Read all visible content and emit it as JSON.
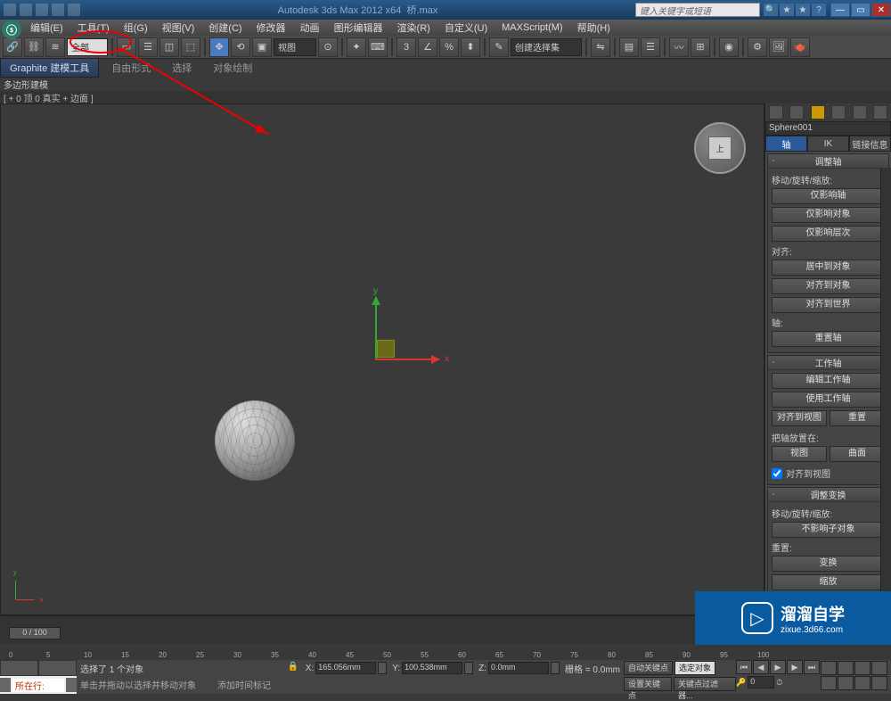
{
  "title": {
    "app": "Autodesk 3ds Max  2012  x64",
    "file": "桥.max",
    "search_placeholder": "键入关键字或短语"
  },
  "menu": [
    "编辑(E)",
    "工具(T)",
    "组(G)",
    "视图(V)",
    "创建(C)",
    "修改器",
    "动画",
    "图形编辑器",
    "渲染(R)",
    "自定义(U)",
    "MAXScript(M)",
    "帮助(H)"
  ],
  "toolbar": {
    "all_label": "全部",
    "view_dropdown": "视图",
    "select_set": "创建选择集"
  },
  "graphite": {
    "main_tab": "Graphite 建模工具",
    "subtabs": [
      "自由形式",
      "选择",
      "对象绘制"
    ],
    "poly_label": "多边形建模",
    "viewport_label": "[ + 0 顶 0 真实 + 边面 ]"
  },
  "viewcube_face": "上",
  "gizmo": {
    "x": "x",
    "y": "y"
  },
  "panel": {
    "object_name": "Sphere001",
    "tabs": [
      "轴",
      "IK",
      "链接信息"
    ],
    "rollout_adjust_pivot": "调整轴",
    "group_move_rot_scale": "移动/旋转/缩放:",
    "btn_affect_pivot": "仅影响轴",
    "btn_affect_object": "仅影响对象",
    "btn_affect_hierarchy": "仅影响层次",
    "group_align": "对齐:",
    "btn_center_to_object": "居中到对象",
    "btn_align_to_object": "对齐到对象",
    "btn_align_to_world": "对齐到世界",
    "group_pivot": "轴:",
    "btn_reset_pivot": "重置轴",
    "rollout_working_pivot": "工作轴",
    "btn_edit_wp": "编辑工作轴",
    "btn_use_wp": "使用工作轴",
    "btn_align_to_view": "对齐到视图",
    "btn_reset": "重置",
    "group_place_pivot": "把轴放置在:",
    "btn_view": "视图",
    "btn_surface": "曲面",
    "check_align_to_view": "对齐到视图",
    "rollout_adjust_transform": "调整变换",
    "group_move_rot_scale2": "移动/旋转/缩放:",
    "btn_dont_affect_children": "不影响子对象",
    "group_reset": "重置:",
    "btn_transform": "变换",
    "btn_scale": "缩放"
  },
  "timeline": {
    "slider": "0 / 100",
    "ticks": [
      "0",
      "5",
      "10",
      "15",
      "20",
      "25",
      "30",
      "35",
      "40",
      "45",
      "50",
      "55",
      "60",
      "65",
      "70",
      "75",
      "80",
      "85",
      "90",
      "95",
      "100"
    ]
  },
  "status": {
    "selected": "选择了 1 个对象",
    "hint": "单击并拖动以选择并移动对象",
    "add_time_tag": "添加时间标记",
    "location": "所在行:",
    "x_val": "165.056mm",
    "y_val": "100.538mm",
    "z_val": "0.0mm",
    "grid": "栅格 = 0.0mm",
    "autokey": "自动关键点",
    "selected_pair": "选定对象",
    "setkey": "设置关键点",
    "keyfilter": "关键点过滤器..."
  },
  "watermark": {
    "text_big": "溜溜自学",
    "text_small": "zixue.3d66.com"
  }
}
